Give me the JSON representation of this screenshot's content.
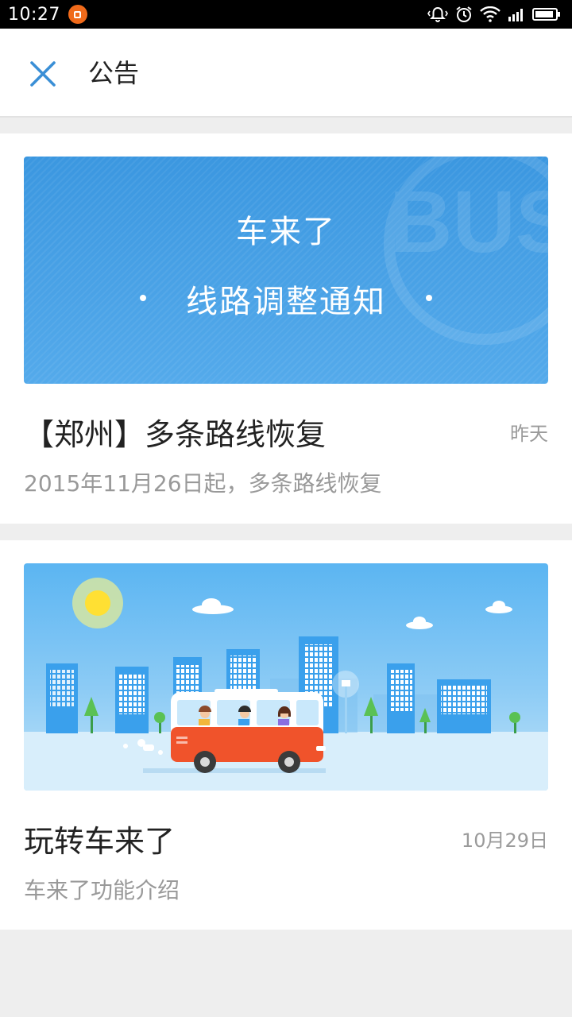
{
  "status_bar": {
    "time": "10:27",
    "app_icon": "orange-notification-icon",
    "icons": [
      "vibrate-bell-icon",
      "alarm-icon",
      "wifi-icon",
      "signal-icon",
      "battery-icon"
    ]
  },
  "header": {
    "close_icon": "close-icon",
    "title": "公告",
    "accent_color": "#3a8fd6"
  },
  "notices": [
    {
      "banner": {
        "line1": "车来了",
        "line2": "线路调整通知",
        "watermark": "BUS",
        "color": "#4aa3e6"
      },
      "title": "【郑州】多条路线恢复",
      "date": "昨天",
      "description": "2015年11月26日起，多条路线恢复"
    },
    {
      "banner": {
        "illustration": "bus-city-illustration",
        "color": "#6cbcf2"
      },
      "title": "玩转车来了",
      "date": "10月29日",
      "description": "车来了功能介绍"
    }
  ]
}
